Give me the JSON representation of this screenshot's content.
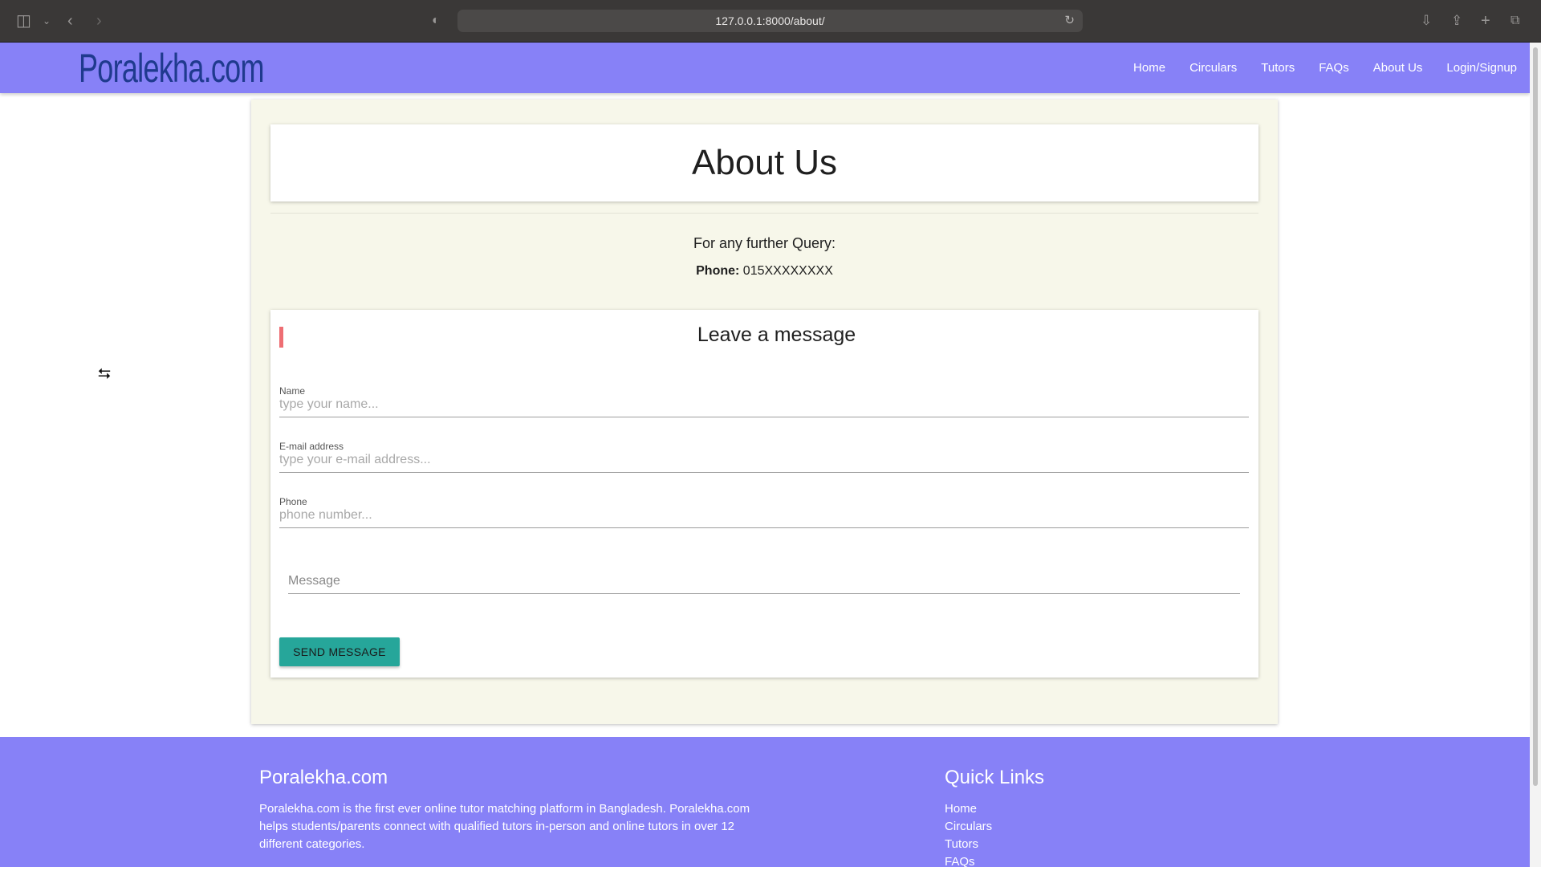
{
  "browser": {
    "url": "127.0.0.1:8000/about/",
    "icons": [
      "sidebar-icon",
      "chevron-down-icon",
      "back-icon",
      "forward-icon",
      "shield-icon",
      "reload-icon",
      "download-icon",
      "share-icon",
      "new-tab-icon",
      "tabs-overview-icon"
    ]
  },
  "navbar": {
    "brand": "Poralekha.com",
    "links": [
      "Home",
      "Circulars",
      "Tutors",
      "FAQs",
      "About Us",
      "Login/Signup"
    ]
  },
  "main": {
    "title": "About Us",
    "query_text": "For any further Query:",
    "phone_label": "Phone:",
    "phone_value": "015XXXXXXXX"
  },
  "message_form": {
    "title": "Leave a message",
    "name_label": "Name",
    "name_placeholder": "type your name...",
    "email_label": "E-mail address",
    "email_placeholder": "type your e-mail address...",
    "phone_label": "Phone",
    "phone_placeholder": "phone number...",
    "message_placeholder": "Message",
    "send_label": "SEND MESSAGE"
  },
  "footer": {
    "brand": "Poralekha.com",
    "about_text": "Poralekha.com is the first ever online tutor matching platform in Bangladesh. Poralekha.com helps students/parents connect with qualified tutors in-person and online tutors in over 12 different categories.",
    "quick_links_title": "Quick Links",
    "quick_links": [
      "Home",
      "Circulars",
      "Tutors",
      "FAQs"
    ]
  },
  "colors": {
    "navbar": "#8781f7",
    "panel": "#f7f7ea",
    "button": "#26a69a",
    "accent": "#ee6e73",
    "brand_text": "#1f3a8e"
  }
}
